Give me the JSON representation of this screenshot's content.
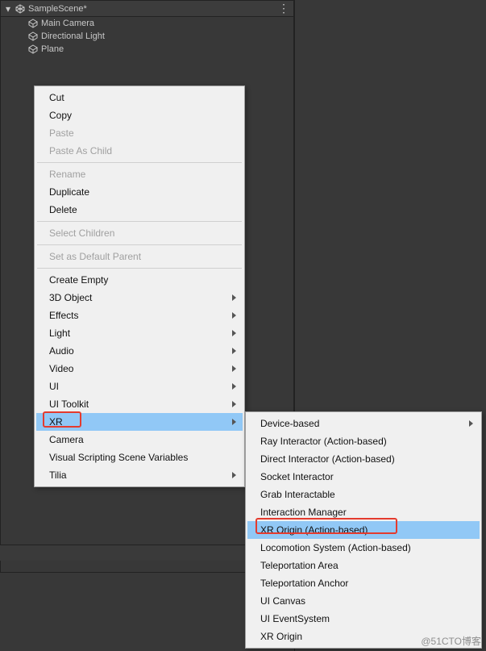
{
  "hierarchy": {
    "scene_name": "SampleScene*",
    "items": [
      {
        "label": "Main Camera"
      },
      {
        "label": "Directional Light"
      },
      {
        "label": "Plane"
      }
    ]
  },
  "footer": {
    "count": "0"
  },
  "menu1": {
    "groups": [
      [
        {
          "label": "Cut"
        },
        {
          "label": "Copy"
        },
        {
          "label": "Paste",
          "disabled": true
        },
        {
          "label": "Paste As Child",
          "disabled": true
        }
      ],
      [
        {
          "label": "Rename",
          "disabled": true
        },
        {
          "label": "Duplicate"
        },
        {
          "label": "Delete"
        }
      ],
      [
        {
          "label": "Select Children",
          "disabled": true
        }
      ],
      [
        {
          "label": "Set as Default Parent",
          "disabled": true
        }
      ],
      [
        {
          "label": "Create Empty"
        },
        {
          "label": "3D Object",
          "haschild": true
        },
        {
          "label": "Effects",
          "haschild": true
        },
        {
          "label": "Light",
          "haschild": true
        },
        {
          "label": "Audio",
          "haschild": true
        },
        {
          "label": "Video",
          "haschild": true
        },
        {
          "label": "UI",
          "haschild": true
        },
        {
          "label": "UI Toolkit",
          "haschild": true
        },
        {
          "label": "XR",
          "haschild": true,
          "highlight": true
        },
        {
          "label": "Camera"
        },
        {
          "label": "Visual Scripting Scene Variables"
        },
        {
          "label": "Tilia",
          "haschild": true
        }
      ]
    ]
  },
  "menu2": {
    "items": [
      {
        "label": "Device-based",
        "haschild": true
      },
      {
        "label": "Ray Interactor (Action-based)"
      },
      {
        "label": "Direct Interactor (Action-based)"
      },
      {
        "label": "Socket Interactor"
      },
      {
        "label": "Grab Interactable"
      },
      {
        "label": "Interaction Manager"
      },
      {
        "label": "XR Origin (Action-based)",
        "highlight": true
      },
      {
        "label": "Locomotion System (Action-based)"
      },
      {
        "label": "Teleportation Area"
      },
      {
        "label": "Teleportation Anchor"
      },
      {
        "label": "UI Canvas"
      },
      {
        "label": "UI EventSystem"
      },
      {
        "label": "XR Origin"
      }
    ]
  },
  "watermark": "@51CTO博客"
}
